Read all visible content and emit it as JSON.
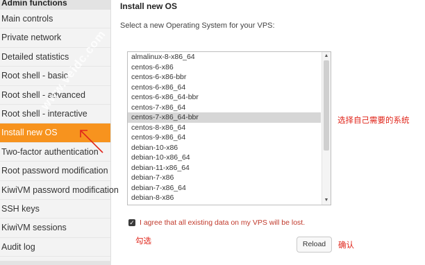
{
  "sidebar": {
    "header": "Admin functions",
    "items": [
      {
        "label": "Main controls"
      },
      {
        "label": "Private network"
      },
      {
        "label": "Detailed statistics"
      },
      {
        "label": "Root shell - basic"
      },
      {
        "label": "Root shell - advanced"
      },
      {
        "label": "Root shell - interactive"
      },
      {
        "label": "Install new OS",
        "active": true
      },
      {
        "label": "Two-factor authentication"
      },
      {
        "label": "Root password modification"
      },
      {
        "label": "KiwiVM password modification"
      },
      {
        "label": "SSH keys"
      },
      {
        "label": "KiwiVM sessions"
      },
      {
        "label": "Audit log"
      }
    ],
    "active_color": "#f7931e"
  },
  "main": {
    "title": "Install new OS",
    "subtitle": "Select a new Operating System for your VPS:",
    "os_list": [
      "almalinux-8-x86_64",
      "centos-6-x86",
      "centos-6-x86-bbr",
      "centos-6-x86_64",
      "centos-6-x86_64-bbr",
      "centos-7-x86_64",
      "centos-7-x86_64-bbr",
      "centos-8-x86_64",
      "centos-9-x86_64",
      "debian-10-x86",
      "debian-10-x86_64",
      "debian-11-x86_64",
      "debian-7-x86",
      "debian-7-x86_64",
      "debian-8-x86"
    ],
    "selected_os": "centos-7-x86_64-bbr",
    "agree_label": "I agree that all existing data on my VPS will be lost.",
    "agree_checked": true,
    "reload_label": "Reload"
  },
  "annotations": {
    "select_os": "选择自己需要的系统",
    "check": "勾选",
    "confirm": "确认",
    "color": "#e0261b"
  },
  "watermark": "www.veidc.com"
}
